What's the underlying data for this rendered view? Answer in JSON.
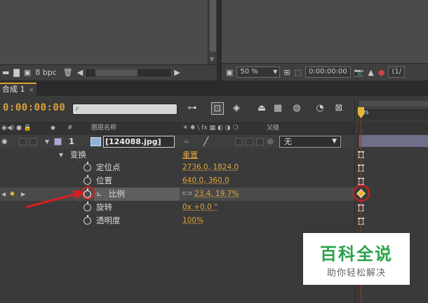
{
  "project_toolbar": {
    "bit_depth": "8 bpc"
  },
  "viewer_toolbar": {
    "zoom": "50 %",
    "timecode": "0:00:00:00",
    "resolution": "(1/"
  },
  "timeline": {
    "tab_label": "合成 1",
    "tab_close": "×",
    "current_time": "0:00:00:00",
    "ruler_label": "0s",
    "columns": {
      "index": "#",
      "layer_name": "图层名称",
      "switches": "☀ ✱ \\ fx ▦ ◐ ◑ ❍",
      "parent": "父级"
    },
    "layer": {
      "index": "1",
      "name": "[124088.jpg]",
      "parent": "无"
    },
    "transform": {
      "label": "变换",
      "reset": "重置"
    },
    "properties": [
      {
        "name": "定位点",
        "value": "2736.0, 1824.0"
      },
      {
        "name": "位置",
        "value": "640.0, 360.0"
      },
      {
        "name": "比例",
        "value": "23.4, 19.7%"
      },
      {
        "name": "旋转",
        "value": "0x +0.0 °"
      },
      {
        "name": "透明度",
        "value": "100%"
      }
    ]
  },
  "watermark": {
    "title": "百科全说",
    "subtitle": "助你轻松解决"
  },
  "colors": {
    "accent": "#e0a53c",
    "annotation": "#d42020",
    "watermark_green": "#2aa24a"
  }
}
